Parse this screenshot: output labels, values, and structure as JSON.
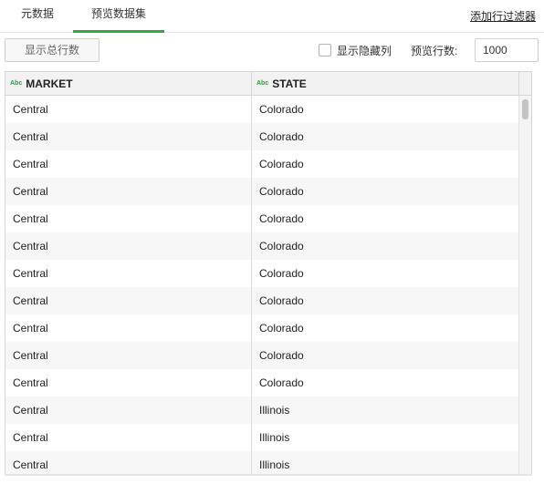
{
  "tabs": {
    "metadata": "元数据",
    "preview": "预览数据集"
  },
  "add_filter": "添加行过滤器",
  "toolbar": {
    "show_total": "显示总行数",
    "show_hidden_columns": "显示隐藏列",
    "preview_rows_label": "预览行数:",
    "preview_rows_value": "1000"
  },
  "columns": [
    {
      "type_icon": "Abc",
      "name": "MARKET"
    },
    {
      "type_icon": "Abc",
      "name": "STATE"
    }
  ],
  "rows": [
    [
      "Central",
      "Colorado"
    ],
    [
      "Central",
      "Colorado"
    ],
    [
      "Central",
      "Colorado"
    ],
    [
      "Central",
      "Colorado"
    ],
    [
      "Central",
      "Colorado"
    ],
    [
      "Central",
      "Colorado"
    ],
    [
      "Central",
      "Colorado"
    ],
    [
      "Central",
      "Colorado"
    ],
    [
      "Central",
      "Colorado"
    ],
    [
      "Central",
      "Colorado"
    ],
    [
      "Central",
      "Colorado"
    ],
    [
      "Central",
      "Illinois"
    ],
    [
      "Central",
      "Illinois"
    ],
    [
      "Central",
      "Illinois"
    ]
  ],
  "colors": {
    "accent": "#2dab49",
    "type_icon": "#2c9b3f"
  }
}
